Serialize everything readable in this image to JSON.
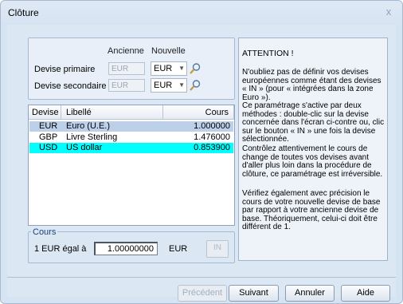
{
  "window": {
    "title": "Clôture",
    "close_glyph": "x"
  },
  "devise": {
    "col_old": "Ancienne",
    "col_new": "Nouvelle",
    "primary_label": "Devise primaire",
    "primary_old": "EUR",
    "primary_new": "EUR",
    "secondary_label": "Devise secondaire",
    "secondary_old": "EUR",
    "secondary_new": "EUR"
  },
  "table": {
    "headers": {
      "devise": "Devise",
      "libelle": "Libellé",
      "cours": "Cours"
    },
    "rows": [
      {
        "code": "EUR",
        "label": "Euro (U.E.)",
        "rate": "1.000000",
        "state": "selected"
      },
      {
        "code": "GBP",
        "label": "Livre Sterling",
        "rate": "1.476000",
        "state": "normal"
      },
      {
        "code": "USD",
        "label": "US dollar",
        "rate": "0.853900",
        "state": "highlighted"
      }
    ]
  },
  "cours": {
    "title": "Cours",
    "label": "1 EUR égal à",
    "value": "1.00000000",
    "unit": "EUR",
    "in_button": "IN"
  },
  "info": {
    "title": "ATTENTION !",
    "p1": "N'oubliez pas de définir vos devises européennes comme étant des devises « IN » (pour « intégrées dans la zone Euro »).",
    "p2": "Ce paramétrage s'active par deux méthodes : double-clic sur la devise concernée dans l'écran ci-contre ou, clic sur le bouton « IN » une fois la devise sélectionnée.",
    "p3": "Contrôlez attentivement le cours de change de toutes vos devises avant d'aller plus loin dans la procédure de clôture, ce paramétrage est irréversible.",
    "p4": "Vérifiez également avec précision le cours de votre nouvelle devise de base par rapport à votre ancienne devise de base. Théoriquement, celui-ci doit être différent de 1."
  },
  "buttons": {
    "previous": "Précédent",
    "next": "Suivant",
    "cancel": "Annuler",
    "help": "Aide"
  },
  "colors": {
    "selected_row": "#bcd0ea",
    "highlight_row": "#00ffff",
    "accent": "#1f3f73"
  }
}
